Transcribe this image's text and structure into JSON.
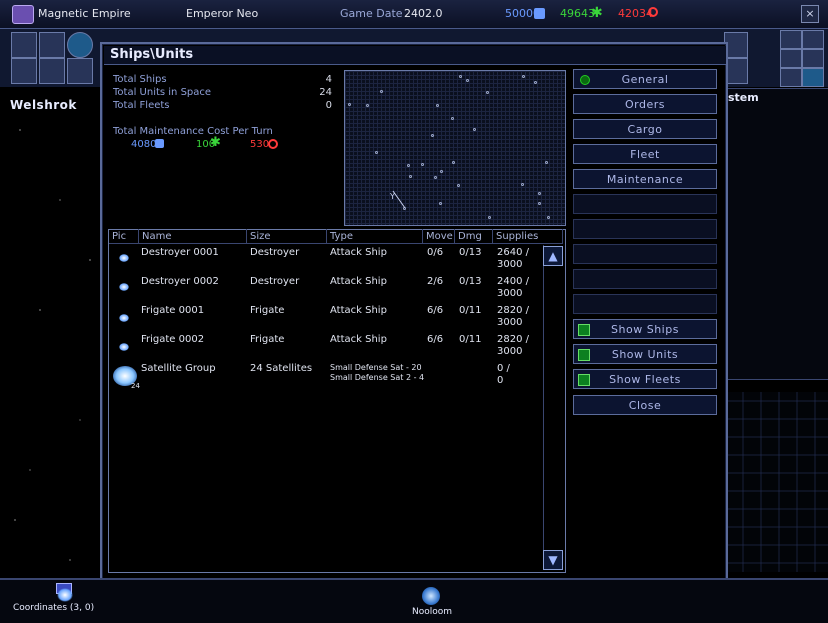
{
  "topbar": {
    "empire": "Magnetic Empire",
    "emperor": "Emperor Neo",
    "game_date_label": "Game Date",
    "game_date": "2402.0",
    "res_blue": "50000",
    "res_green": "49643",
    "res_red": "42034",
    "colors": {
      "blue": "#6a9aff",
      "green": "#3ad63a",
      "red": "#ff3a3a"
    }
  },
  "left": {
    "planet_name": "Welshrok",
    "coordinates": "Coordinates (3, 0)"
  },
  "bottom": {
    "planet_name": "Nooloom"
  },
  "right_partial": "stem",
  "dialog": {
    "title": "Ships\\Units",
    "stats": [
      {
        "label": "Total Ships",
        "value": "4"
      },
      {
        "label": "Total Units in Space",
        "value": "24"
      },
      {
        "label": "Total Fleets",
        "value": "0"
      }
    ],
    "maint_label": "Total Maintenance Cost Per Turn",
    "maint_blue": "4080",
    "maint_green": "100",
    "maint_red": "530",
    "columns": [
      "Pic",
      "Name",
      "Size",
      "Type",
      "Move",
      "Dmg",
      "Supplies"
    ],
    "rows": [
      {
        "name": "Destroyer 0001",
        "size": "Destroyer",
        "type": "Attack Ship",
        "type2": "",
        "move": "0/6",
        "dmg": "0/13",
        "supplies": "2640 /",
        "supplies2": "3000"
      },
      {
        "name": "Destroyer 0002",
        "size": "Destroyer",
        "type": "Attack Ship",
        "type2": "",
        "move": "2/6",
        "dmg": "0/13",
        "supplies": "2400 /",
        "supplies2": "3000"
      },
      {
        "name": "Frigate 0001",
        "size": "Frigate",
        "type": "Attack Ship",
        "type2": "",
        "move": "6/6",
        "dmg": "0/11",
        "supplies": "2820 /",
        "supplies2": "3000"
      },
      {
        "name": "Frigate 0002",
        "size": "Frigate",
        "type": "Attack Ship",
        "type2": "",
        "move": "6/6",
        "dmg": "0/11",
        "supplies": "2820 /",
        "supplies2": "3000"
      },
      {
        "name": "Satellite Group",
        "size": "24 Satellites",
        "type": "Small Defense Sat - 20",
        "type2": "Small Defense Sat 2 - 4",
        "move": "",
        "dmg": "",
        "supplies": "0 /",
        "supplies2": "0"
      }
    ],
    "satellite_badge": "24",
    "buttons": {
      "general": "General",
      "orders": "Orders",
      "cargo": "Cargo",
      "fleet": "Fleet",
      "maintenance": "Maintenance",
      "show_ships": "Show Ships",
      "show_units": "Show Units",
      "show_fleets": "Show Fleets",
      "close": "Close"
    }
  },
  "window_close": "×"
}
